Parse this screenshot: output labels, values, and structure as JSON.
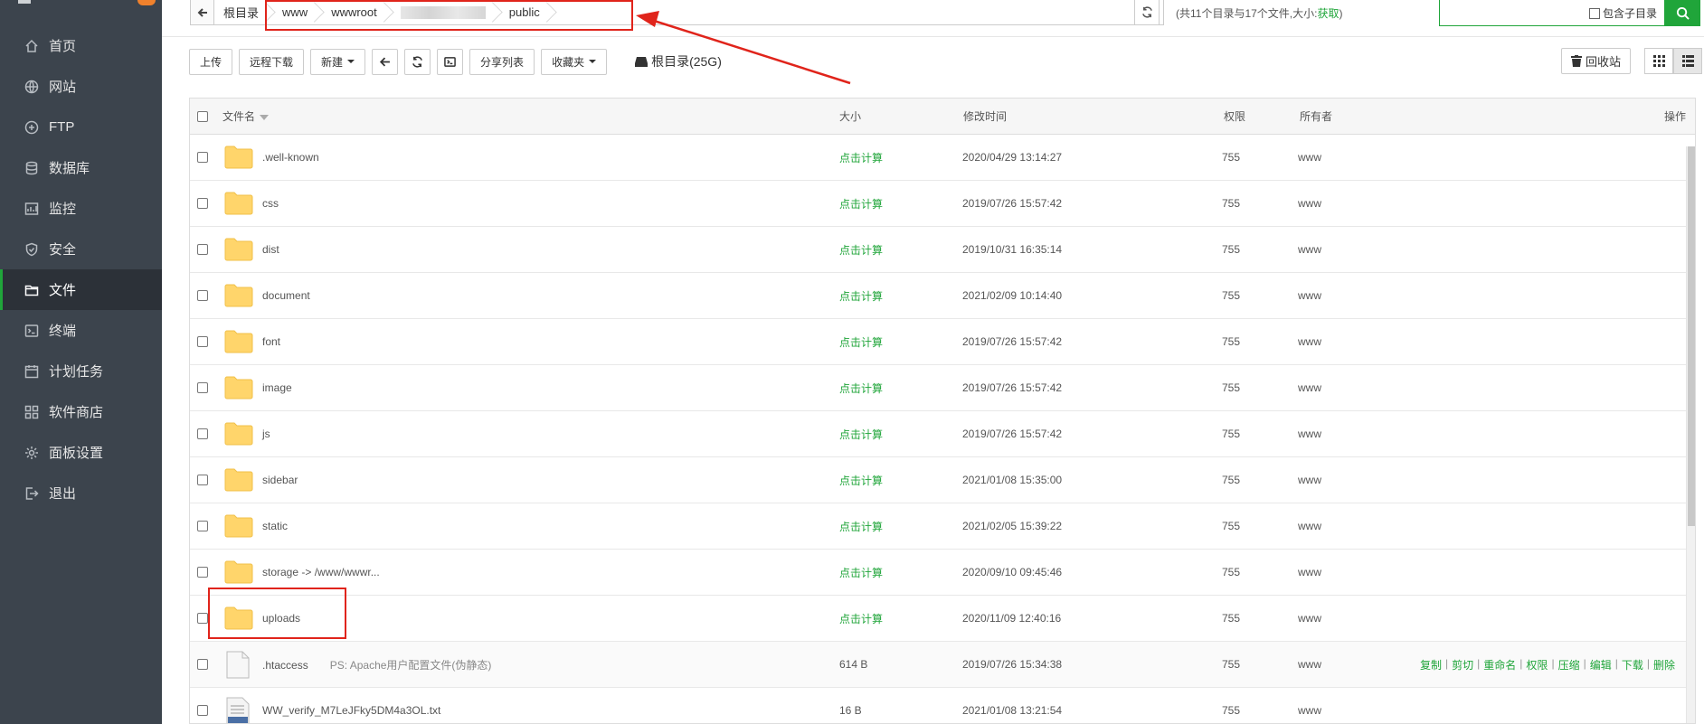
{
  "sidebar": {
    "items": [
      {
        "label": "首页",
        "icon": "home-icon"
      },
      {
        "label": "网站",
        "icon": "globe-icon"
      },
      {
        "label": "FTP",
        "icon": "ftp-icon"
      },
      {
        "label": "数据库",
        "icon": "database-icon"
      },
      {
        "label": "监控",
        "icon": "monitor-icon"
      },
      {
        "label": "安全",
        "icon": "shield-icon"
      },
      {
        "label": "文件",
        "icon": "folder-icon",
        "active": true
      },
      {
        "label": "终端",
        "icon": "terminal-icon"
      },
      {
        "label": "计划任务",
        "icon": "calendar-icon"
      },
      {
        "label": "软件商店",
        "icon": "apps-icon"
      },
      {
        "label": "面板设置",
        "icon": "gear-icon"
      },
      {
        "label": "退出",
        "icon": "logout-icon"
      }
    ]
  },
  "pathbar": {
    "crumbs": [
      "根目录",
      "www",
      "wwwroot",
      "",
      "public"
    ],
    "summary_prefix": "(共11个目录与17个文件,大小:",
    "summary_link": "获取",
    "summary_suffix": ")",
    "search_placeholder": "",
    "subdir_label": "包含子目录"
  },
  "toolbar": {
    "upload": "上传",
    "remote_download": "远程下载",
    "new": "新建",
    "share_list": "分享列表",
    "favorites": "收藏夹",
    "disk_label": "根目录(25G)",
    "recycle_bin": "回收站"
  },
  "table": {
    "headers": {
      "name": "文件名",
      "size": "大小",
      "mtime": "修改时间",
      "perm": "权限",
      "owner": "所有者",
      "ops": "操作"
    },
    "rows": [
      {
        "type": "folder",
        "name": ".well-known",
        "size": "点击计算",
        "mtime": "2020/04/29 13:14:27",
        "perm": "755",
        "owner": "www"
      },
      {
        "type": "folder",
        "name": "css",
        "size": "点击计算",
        "mtime": "2019/07/26 15:57:42",
        "perm": "755",
        "owner": "www"
      },
      {
        "type": "folder",
        "name": "dist",
        "size": "点击计算",
        "mtime": "2019/10/31 16:35:14",
        "perm": "755",
        "owner": "www"
      },
      {
        "type": "folder",
        "name": "document",
        "size": "点击计算",
        "mtime": "2021/02/09 10:14:40",
        "perm": "755",
        "owner": "www"
      },
      {
        "type": "folder",
        "name": "font",
        "size": "点击计算",
        "mtime": "2019/07/26 15:57:42",
        "perm": "755",
        "owner": "www"
      },
      {
        "type": "folder",
        "name": "image",
        "size": "点击计算",
        "mtime": "2019/07/26 15:57:42",
        "perm": "755",
        "owner": "www"
      },
      {
        "type": "folder",
        "name": "js",
        "size": "点击计算",
        "mtime": "2019/07/26 15:57:42",
        "perm": "755",
        "owner": "www"
      },
      {
        "type": "folder",
        "name": "sidebar",
        "size": "点击计算",
        "mtime": "2021/01/08 15:35:00",
        "perm": "755",
        "owner": "www"
      },
      {
        "type": "folder",
        "name": "static",
        "size": "点击计算",
        "mtime": "2021/02/05 15:39:22",
        "perm": "755",
        "owner": "www"
      },
      {
        "type": "folder",
        "name": "storage -> /www/wwwr...",
        "size": "点击计算",
        "mtime": "2020/09/10 09:45:46",
        "perm": "755",
        "owner": "www"
      },
      {
        "type": "folder",
        "name": "uploads",
        "size": "点击计算",
        "mtime": "2020/11/09 12:40:16",
        "perm": "755",
        "owner": "www"
      },
      {
        "type": "file",
        "name": ".htaccess",
        "note": "PS: Apache用户配置文件(伪静态)",
        "size": "614 B",
        "mtime": "2019/07/26 15:34:38",
        "perm": "755",
        "owner": "www",
        "ops": [
          "复制",
          "剪切",
          "重命名",
          "权限",
          "压缩",
          "编辑",
          "下载",
          "删除"
        ]
      },
      {
        "type": "file",
        "name": "WW_verify_M7LeJFky5DM4a3OL.txt",
        "size": "16 B",
        "mtime": "2021/01/08 13:21:54",
        "perm": "755",
        "owner": "www"
      }
    ]
  },
  "colors": {
    "accent": "#20a53a",
    "sidebar_bg": "#3c444d",
    "annotation": "#e0241b",
    "folder": "#ffd56b"
  }
}
